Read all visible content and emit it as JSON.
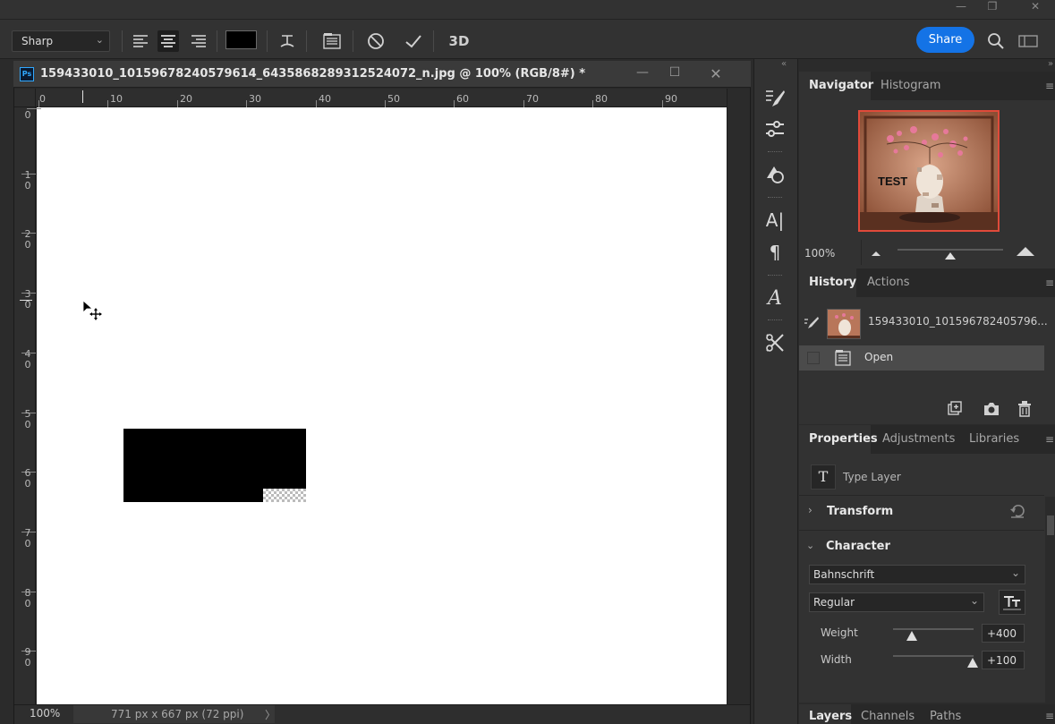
{
  "options_bar": {
    "antialias": "Sharp",
    "text_color": "#000000",
    "share_label": "Share",
    "three_d_label": "3D"
  },
  "document": {
    "title": "159433010_10159678240579614_6435868289312524072_n.jpg @ 100% (RGB/8#) *",
    "ps_badge": "Ps",
    "h_ruler": [
      "0",
      "10",
      "20",
      "30",
      "40",
      "50",
      "60",
      "70",
      "80",
      "90"
    ],
    "v_ruler": [
      [
        "0",
        ""
      ],
      [
        "1",
        "0"
      ],
      [
        "2",
        "0"
      ],
      [
        "3",
        "0"
      ],
      [
        "4",
        "0"
      ],
      [
        "5",
        "0"
      ],
      [
        "6",
        "0"
      ],
      [
        "7",
        "0"
      ],
      [
        "8",
        "0"
      ],
      [
        "9",
        "0"
      ]
    ],
    "status_zoom": "100%",
    "status_info": "771 px x 667 px (72 ppi)"
  },
  "navigator_panel": {
    "tabs": [
      "Navigator",
      "Histogram"
    ],
    "zoom": "100%",
    "thumb_text": "TEST"
  },
  "history_panel": {
    "tabs": [
      "History",
      "Actions"
    ],
    "snapshot_name": "159433010_101596782405796...",
    "items": [
      "Open"
    ]
  },
  "properties_panel": {
    "tabs": [
      "Properties",
      "Adjustments",
      "Libraries"
    ],
    "layer_type": "Type Layer",
    "transform_label": "Transform",
    "character_label": "Character",
    "font_family": "Bahnschrift",
    "font_style": "Regular",
    "weight_label": "Weight",
    "weight_value": "+400",
    "width_label": "Width",
    "width_value": "+100"
  },
  "layers_panel": {
    "tabs": [
      "Layers",
      "Channels",
      "Paths"
    ]
  }
}
